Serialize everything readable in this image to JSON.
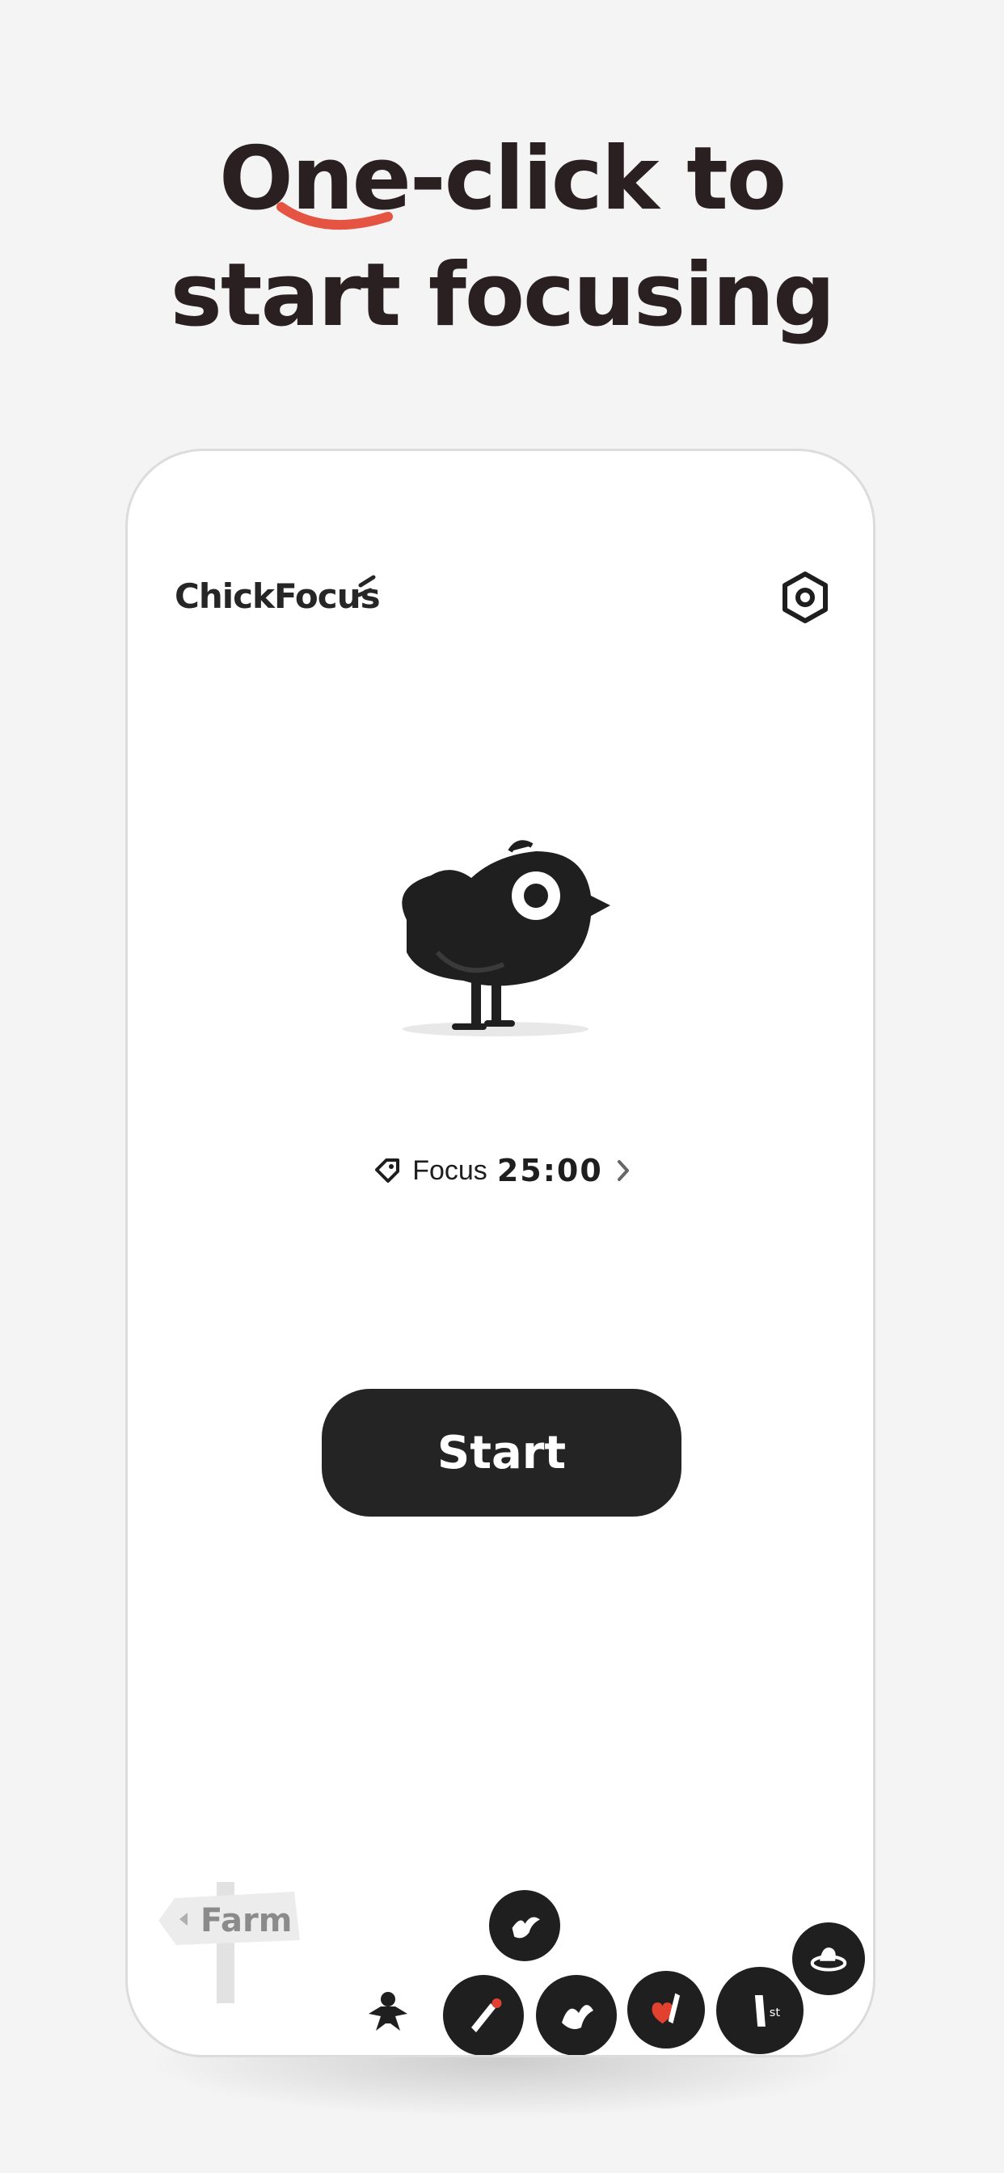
{
  "headline": {
    "line1": "One-click to",
    "line2": "start focusing"
  },
  "app": {
    "logo": "ChickFocus",
    "focus_label": "Focus",
    "focus_time": "25:00",
    "start_label": "Start",
    "farm_label": "Farm"
  },
  "colors": {
    "accent": "#e3412f",
    "dark": "#242424",
    "headline": "#2a2022"
  },
  "icons": [
    "settings-icon",
    "tag-icon",
    "chevron-right-icon",
    "chick-icon",
    "farm-sign-icon"
  ]
}
